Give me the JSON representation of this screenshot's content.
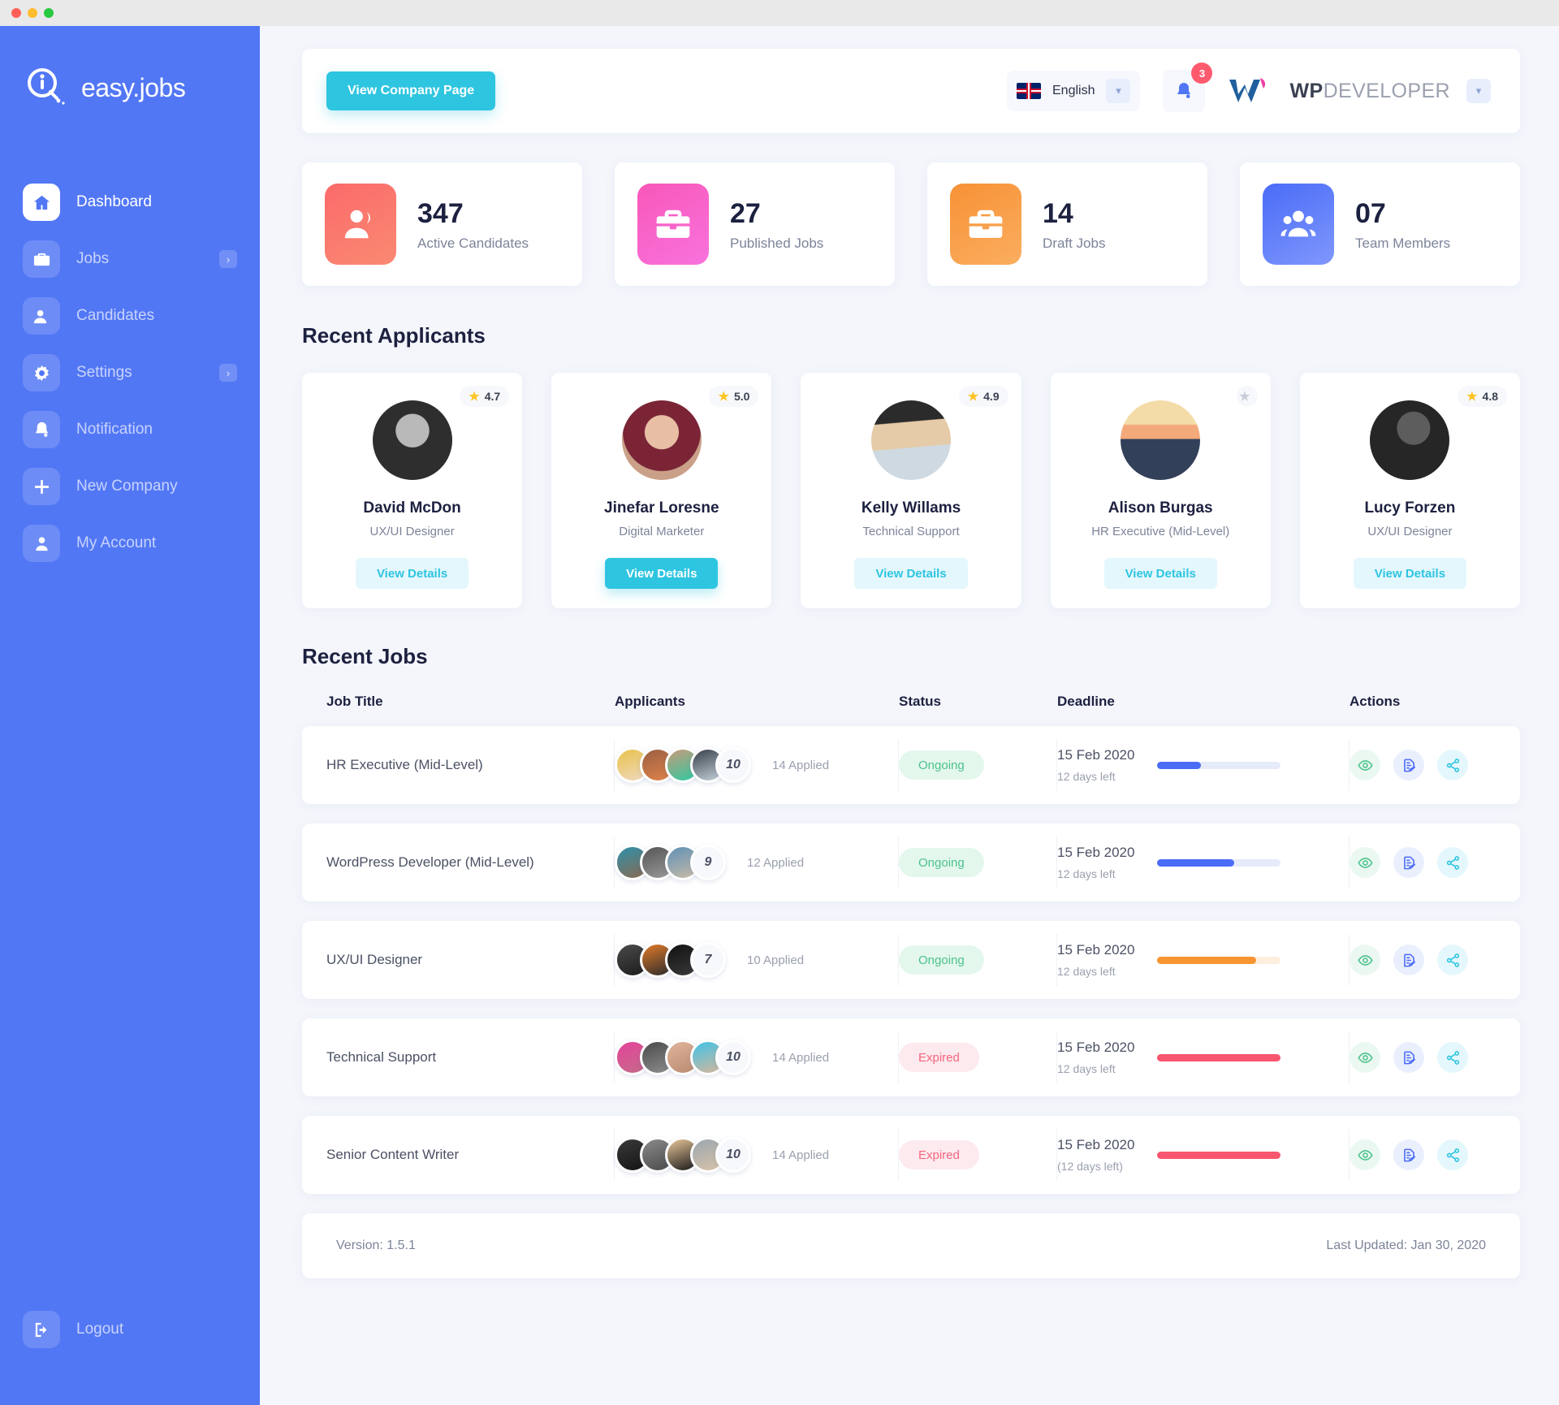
{
  "window": {
    "dots": [
      "close",
      "minimize",
      "maximize"
    ]
  },
  "sidebar": {
    "brand": "easy.jobs",
    "items": [
      {
        "label": "Dashboard",
        "icon": "home-icon",
        "active": true,
        "arrow": ""
      },
      {
        "label": "Jobs",
        "icon": "briefcase-icon",
        "active": false,
        "arrow": "›"
      },
      {
        "label": "Candidates",
        "icon": "user-icon",
        "active": false,
        "arrow": ""
      },
      {
        "label": "Settings",
        "icon": "gear-icon",
        "active": false,
        "arrow": "›"
      },
      {
        "label": "Notification",
        "icon": "bell-icon",
        "active": false,
        "arrow": ""
      },
      {
        "label": "New Company",
        "icon": "plus-icon",
        "active": false,
        "arrow": ""
      },
      {
        "label": "My Account",
        "icon": "person-icon",
        "active": false,
        "arrow": ""
      }
    ],
    "logout": "Logout",
    "logout_icon": "logout-icon"
  },
  "topbar": {
    "company_button": "View Company Page",
    "language": "English",
    "language_flag": "uk-flag-icon",
    "language_chevron": "chevron-down-icon",
    "notification_icon": "bell-icon",
    "notification_count": "3",
    "account_name_bold": "WP",
    "account_name_light": "DEVELOPER",
    "account_chevron": "chevron-down-icon"
  },
  "stats": [
    {
      "value": "347",
      "label": "Active Candidates",
      "icon": "candidates-icon",
      "color_from": "#fb6a6a",
      "color_to": "#fa8a72"
    },
    {
      "value": "27",
      "label": "Published Jobs",
      "icon": "briefcase-icon",
      "color_from": "#f857b8",
      "color_to": "#f768d8"
    },
    {
      "value": "14",
      "label": "Draft Jobs",
      "icon": "briefcase-icon",
      "color_from": "#f79135",
      "color_to": "#fbac5c"
    },
    {
      "value": "07",
      "label": "Team Members",
      "icon": "team-icon",
      "color_from": "#4a6cf7",
      "color_to": "#7a92fb"
    }
  ],
  "applicants_section": {
    "title": "Recent Applicants",
    "items": [
      {
        "name": "David McDon",
        "role": "UX/UI Designer",
        "rating": "4.7",
        "has_rating": true,
        "button": "View Details",
        "button_solid": false,
        "avatar_a": "#3a3a3a",
        "avatar_b": "#7d7d7d"
      },
      {
        "name": "Jinefar Loresne",
        "role": "Digital Marketer",
        "rating": "5.0",
        "has_rating": true,
        "button": "View Details",
        "button_solid": true,
        "avatar_a": "#8c4f3f",
        "avatar_b": "#d2a089"
      },
      {
        "name": "Kelly Willams",
        "role": "Technical Support",
        "rating": "4.9",
        "has_rating": true,
        "button": "View Details",
        "button_solid": false,
        "avatar_a": "#8ea3b4",
        "avatar_b": "#cfd9e1"
      },
      {
        "name": "Alison Burgas",
        "role": "HR Executive (Mid-Level)",
        "rating": "",
        "has_rating": false,
        "button": "View Details",
        "button_solid": false,
        "avatar_a": "#f2c79a",
        "avatar_b": "#33405a"
      },
      {
        "name": "Lucy Forzen",
        "role": "UX/UI Designer",
        "rating": "4.8",
        "has_rating": true,
        "button": "View Details",
        "button_solid": false,
        "avatar_a": "#4b4b4b",
        "avatar_b": "#2b2b2b"
      }
    ]
  },
  "jobs_section": {
    "title": "Recent Jobs",
    "columns": [
      "Job Title",
      "Applicants",
      "Status",
      "Deadline",
      "Actions"
    ],
    "rows": [
      {
        "title": "HR Executive (Mid-Level)",
        "count": "10",
        "applied": "14 Applied",
        "status": "Ongoing",
        "status_kind": "ongoing",
        "date": "15 Feb 2020",
        "days_left": "12 days left",
        "progress": 35,
        "bar_color": "blue",
        "avatars": [
          "#e0b43c",
          "#8a5a3c",
          "#2fc9a0",
          "#8fa3b5"
        ]
      },
      {
        "title": "WordPress Developer (Mid-Level)",
        "count": "9",
        "applied": "12 Applied",
        "status": "Ongoing",
        "status_kind": "ongoing",
        "date": "15 Feb 2020",
        "days_left": "12 days left",
        "progress": 62,
        "bar_color": "blue",
        "avatars": [
          "#2e8fa8",
          "#6b6b6b",
          "#5f8fb5"
        ]
      },
      {
        "title": "UX/UI Designer",
        "count": "7",
        "applied": "10 Applied",
        "status": "Ongoing",
        "status_kind": "ongoing",
        "date": "15 Feb 2020",
        "days_left": "12 days left",
        "progress": 80,
        "bar_color": "orange",
        "avatars": [
          "#3b3b3b",
          "#e07a2a",
          "#1e1e1e"
        ]
      },
      {
        "title": "Technical Support",
        "count": "10",
        "applied": "14 Applied",
        "status": "Expired",
        "status_kind": "expired",
        "date": "15 Feb 2020",
        "days_left": "12 days left",
        "progress": 100,
        "bar_color": "red",
        "avatars": [
          "#e5449a",
          "#6a6a6a",
          "#e0b49a",
          "#3fc3e8"
        ]
      },
      {
        "title": "Senior Content Writer",
        "count": "10",
        "applied": "14 Applied",
        "status": "Expired",
        "status_kind": "expired",
        "date": "15 Feb 2020",
        "days_left": "(12 days left)",
        "progress": 100,
        "bar_color": "red",
        "avatars": [
          "#2e2e2e",
          "#777777",
          "#141414",
          "#9aa6b0"
        ]
      }
    ],
    "action_icons": [
      "eye-icon",
      "edit-document-icon",
      "share-icon"
    ]
  },
  "footer": {
    "version": "Version: 1.5.1",
    "last_updated": "Last Updated: Jan 30, 2020"
  }
}
